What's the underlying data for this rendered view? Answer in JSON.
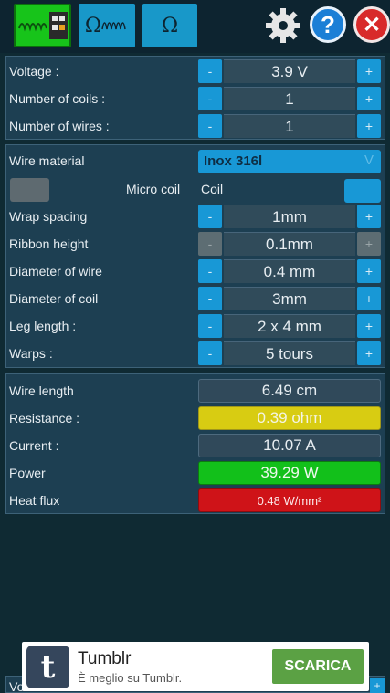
{
  "toolbar": {
    "tab_resistance_symbol": "Ω",
    "tab_ohm_symbol": "Ω",
    "close_symbol": "✕",
    "help_symbol": "?"
  },
  "panel1": {
    "rows": [
      {
        "label": "Voltage :",
        "value": "3.9 V",
        "minus": "-",
        "plus": "+"
      },
      {
        "label": "Number of coils :",
        "value": "1",
        "minus": "-",
        "plus": "+"
      },
      {
        "label": "Number of wires :",
        "value": "1",
        "minus": "-",
        "plus": "+"
      }
    ]
  },
  "panel2": {
    "material_label": "Wire material",
    "material_value": "Inox 316l",
    "material_arrow": "V",
    "micro_coil_label": "Micro coil",
    "coil_label": "Coil",
    "rows": [
      {
        "label": "Wrap spacing",
        "value": "1mm",
        "minus": "-",
        "plus": "+"
      },
      {
        "label": "Ribbon height",
        "value": "0.1mm",
        "minus": "-",
        "plus": "+"
      },
      {
        "label": "Diameter of wire",
        "value": "0.4 mm",
        "minus": "-",
        "plus": "+"
      },
      {
        "label": "Diameter of coil",
        "value": "3mm",
        "minus": "-",
        "plus": "+"
      },
      {
        "label": "Leg length :",
        "value": "2 x 4 mm",
        "minus": "-",
        "plus": "+"
      },
      {
        "label": "Warps :",
        "value": "5 tours",
        "minus": "-",
        "plus": "+"
      }
    ]
  },
  "panel3": {
    "rows": [
      {
        "label": "Wire length",
        "value": "6.49 cm"
      },
      {
        "label": "Resistance :",
        "value": "0.39 ohm"
      },
      {
        "label": "Current :",
        "value": "10.07 A"
      },
      {
        "label": "Power",
        "value": "39.29 W"
      },
      {
        "label": "Heat flux",
        "value": "0.48 W/mm²"
      }
    ]
  },
  "colors": {
    "accent_blue": "#1898d6",
    "active_green": "#17c41a",
    "resistance_yellow": "#d8cc12",
    "power_green": "#12c01a",
    "heat_red": "#cf1318"
  },
  "ad": {
    "logo_letter": "t",
    "title": "Tumblr",
    "subtitle": "È meglio su Tumblr.",
    "button": "SCARICA"
  },
  "bottom": {
    "label": "Vo",
    "plus": "+"
  }
}
